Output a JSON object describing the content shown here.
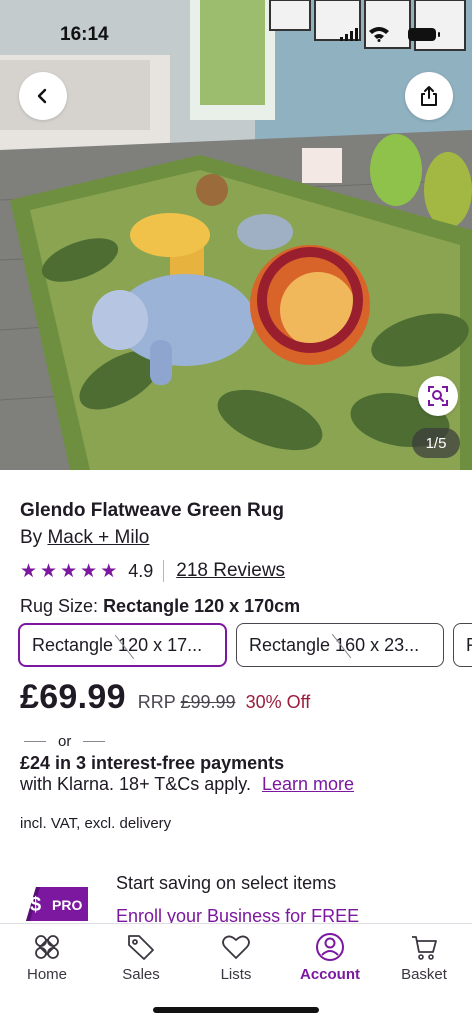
{
  "status_bar": {
    "time": "16:14"
  },
  "hero": {
    "image_counter": "1/5",
    "icons": {
      "back": "chevron-left-icon",
      "share": "share-icon",
      "zoom": "visual-search-icon"
    }
  },
  "product": {
    "title": "Glendo Flatweave Green Rug",
    "brand_prefix": "By",
    "brand": "Mack + Milo",
    "rating_value": "4.9",
    "stars": 5,
    "reviews": "218 Reviews"
  },
  "size": {
    "label_prefix": "Rug Size:",
    "selected": "Rectangle 120 x 170cm",
    "options": [
      "Rectangle 120 x 17...",
      "Rectangle 160 x 23...",
      "R"
    ]
  },
  "pricing": {
    "price": "£69.99",
    "rrp_label": "RRP",
    "rrp_value": "£99.99",
    "discount": "30% Off"
  },
  "klarna": {
    "or": "or",
    "line1": "£24 in 3 interest-free payments",
    "line2": "with Klarna. 18+ T&Cs apply.",
    "link": "Learn more"
  },
  "vat_note": "incl. VAT, excl. delivery",
  "pro_promo": {
    "badge_symbol": "$",
    "badge_text": "PRO",
    "line1": "Start saving on select items",
    "line2": "Enroll your Business for FREE"
  },
  "tabs": [
    {
      "label": "Home",
      "icon": "home-icon"
    },
    {
      "label": "Sales",
      "icon": "tag-icon"
    },
    {
      "label": "Lists",
      "icon": "heart-icon"
    },
    {
      "label": "Account",
      "icon": "account-icon"
    },
    {
      "label": "Basket",
      "icon": "basket-icon"
    }
  ],
  "colors": {
    "accent": "#7b189f",
    "discount": "#9b1c3c",
    "text": "#1f1a24"
  }
}
